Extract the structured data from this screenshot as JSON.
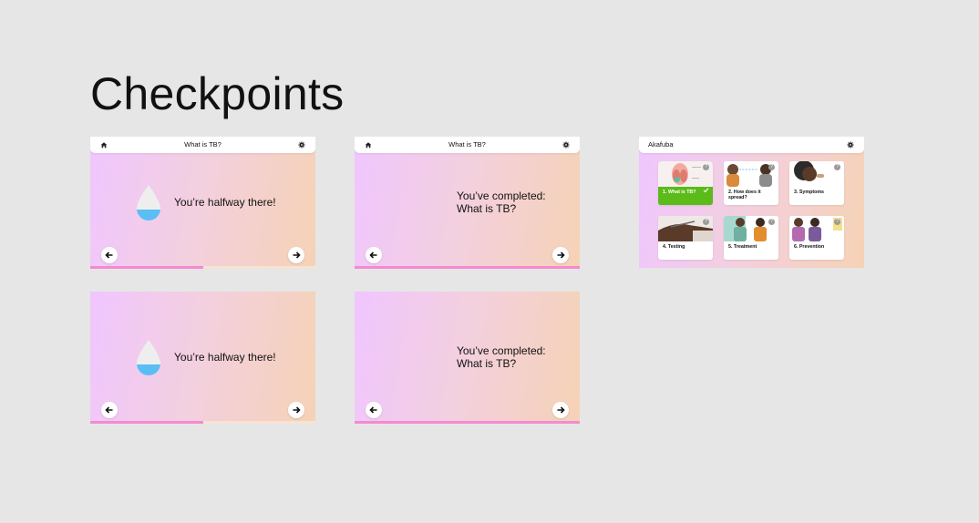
{
  "page": {
    "title": "Checkpoints"
  },
  "screens": [
    {
      "header_title": "What is TB?",
      "message": "You’re halfway there!",
      "progress_percent": 50
    },
    {
      "header_title": "What is TB?",
      "message_line1": "You’ve completed:",
      "message_line2": "What is TB?",
      "progress_percent": 100
    },
    {
      "message": "You’re halfway there!",
      "progress_percent": 50
    },
    {
      "message_line1": "You’ve completed:",
      "message_line2": "What is TB?",
      "progress_percent": 100
    }
  ],
  "menu": {
    "header_title": "Akafuba",
    "cards": [
      {
        "label": "1. What is TB?",
        "completed": true
      },
      {
        "label": "2. How does it spread?",
        "completed": false
      },
      {
        "label": "3. Symptoms",
        "completed": false
      },
      {
        "label": "4. Testing",
        "completed": false
      },
      {
        "label": "5. Treatment",
        "completed": false
      },
      {
        "label": "6. Prevention",
        "completed": false
      }
    ],
    "help_mark": "?"
  },
  "icons": {
    "home": "home-icon",
    "settings": "gear-icon",
    "back": "arrow-left-icon",
    "forward": "arrow-right-icon",
    "drop": "water-drop-icon",
    "check": "check-icon"
  },
  "colors": {
    "background": "#e6e6e6",
    "progress": "#f58ad2",
    "completed_card": "#5bbb18",
    "drop_fill": "#5bbdf5"
  }
}
